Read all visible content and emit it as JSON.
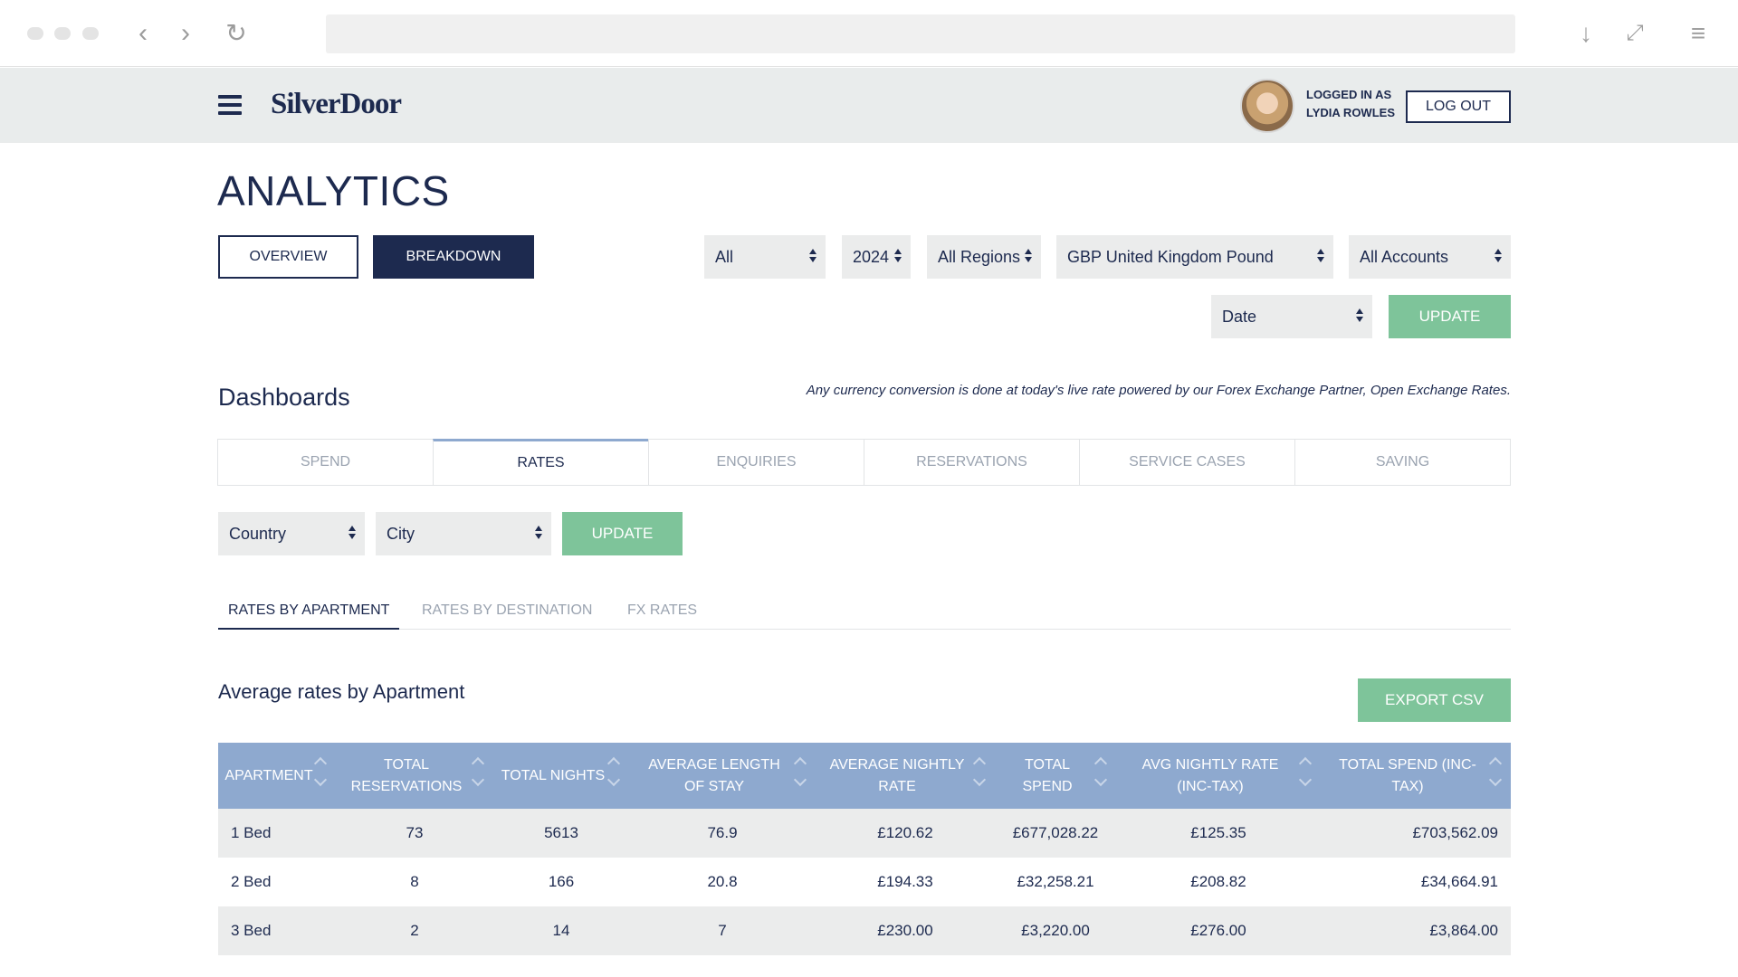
{
  "header": {
    "logo": "SilverDoor",
    "logged_in_line1": "LOGGED IN AS",
    "logged_in_line2": "LYDIA ROWLES",
    "logout_label": "LOG OUT"
  },
  "page": {
    "title": "ANALYTICS",
    "overview_label": "OVERVIEW",
    "breakdown_label": "BREAKDOWN"
  },
  "filters": {
    "period": "All",
    "year": "2024",
    "region": "All Regions",
    "currency": "GBP United Kingdom Pound",
    "accounts": "All Accounts",
    "sort_by": "Date",
    "update_label": "UPDATE"
  },
  "dashboards": {
    "title": "Dashboards",
    "fx_note": "Any currency conversion is done at today's live rate powered by our Forex Exchange Partner, Open Exchange Rates.",
    "tabs": [
      "SPEND",
      "RATES",
      "ENQUIRIES",
      "RESERVATIONS",
      "SERVICE CASES",
      "SAVING"
    ],
    "active_tab": "RATES"
  },
  "location_filters": {
    "country": "Country",
    "city": "City",
    "update_label": "UPDATE"
  },
  "subtabs": [
    "RATES BY APARTMENT",
    "RATES BY DESTINATION",
    "FX RATES"
  ],
  "section": {
    "title": "Average rates by Apartment",
    "export_label": "EXPORT CSV"
  },
  "table": {
    "headers": [
      "APARTMENT",
      "TOTAL RESERVATIONS",
      "TOTAL NIGHTS",
      "AVERAGE LENGTH OF STAY",
      "AVERAGE NIGHTLY RATE",
      "TOTAL SPEND",
      "AVG NIGHTLY RATE (INC-TAX)",
      "TOTAL SPEND (INC-TAX)"
    ],
    "rows": [
      [
        "1 Bed",
        "73",
        "5613",
        "76.9",
        "£120.62",
        "£677,028.22",
        "£125.35",
        "£703,562.09"
      ],
      [
        "2 Bed",
        "8",
        "166",
        "20.8",
        "£194.33",
        "£32,258.21",
        "£208.82",
        "£34,664.91"
      ],
      [
        "3 Bed",
        "2",
        "14",
        "7",
        "£230.00",
        "£3,220.00",
        "£276.00",
        "£3,864.00"
      ]
    ]
  },
  "colors": {
    "navy": "#1d2a4f",
    "green": "#7ec49a",
    "table_header": "#8ea9cf",
    "stripe": "#ebecec"
  }
}
